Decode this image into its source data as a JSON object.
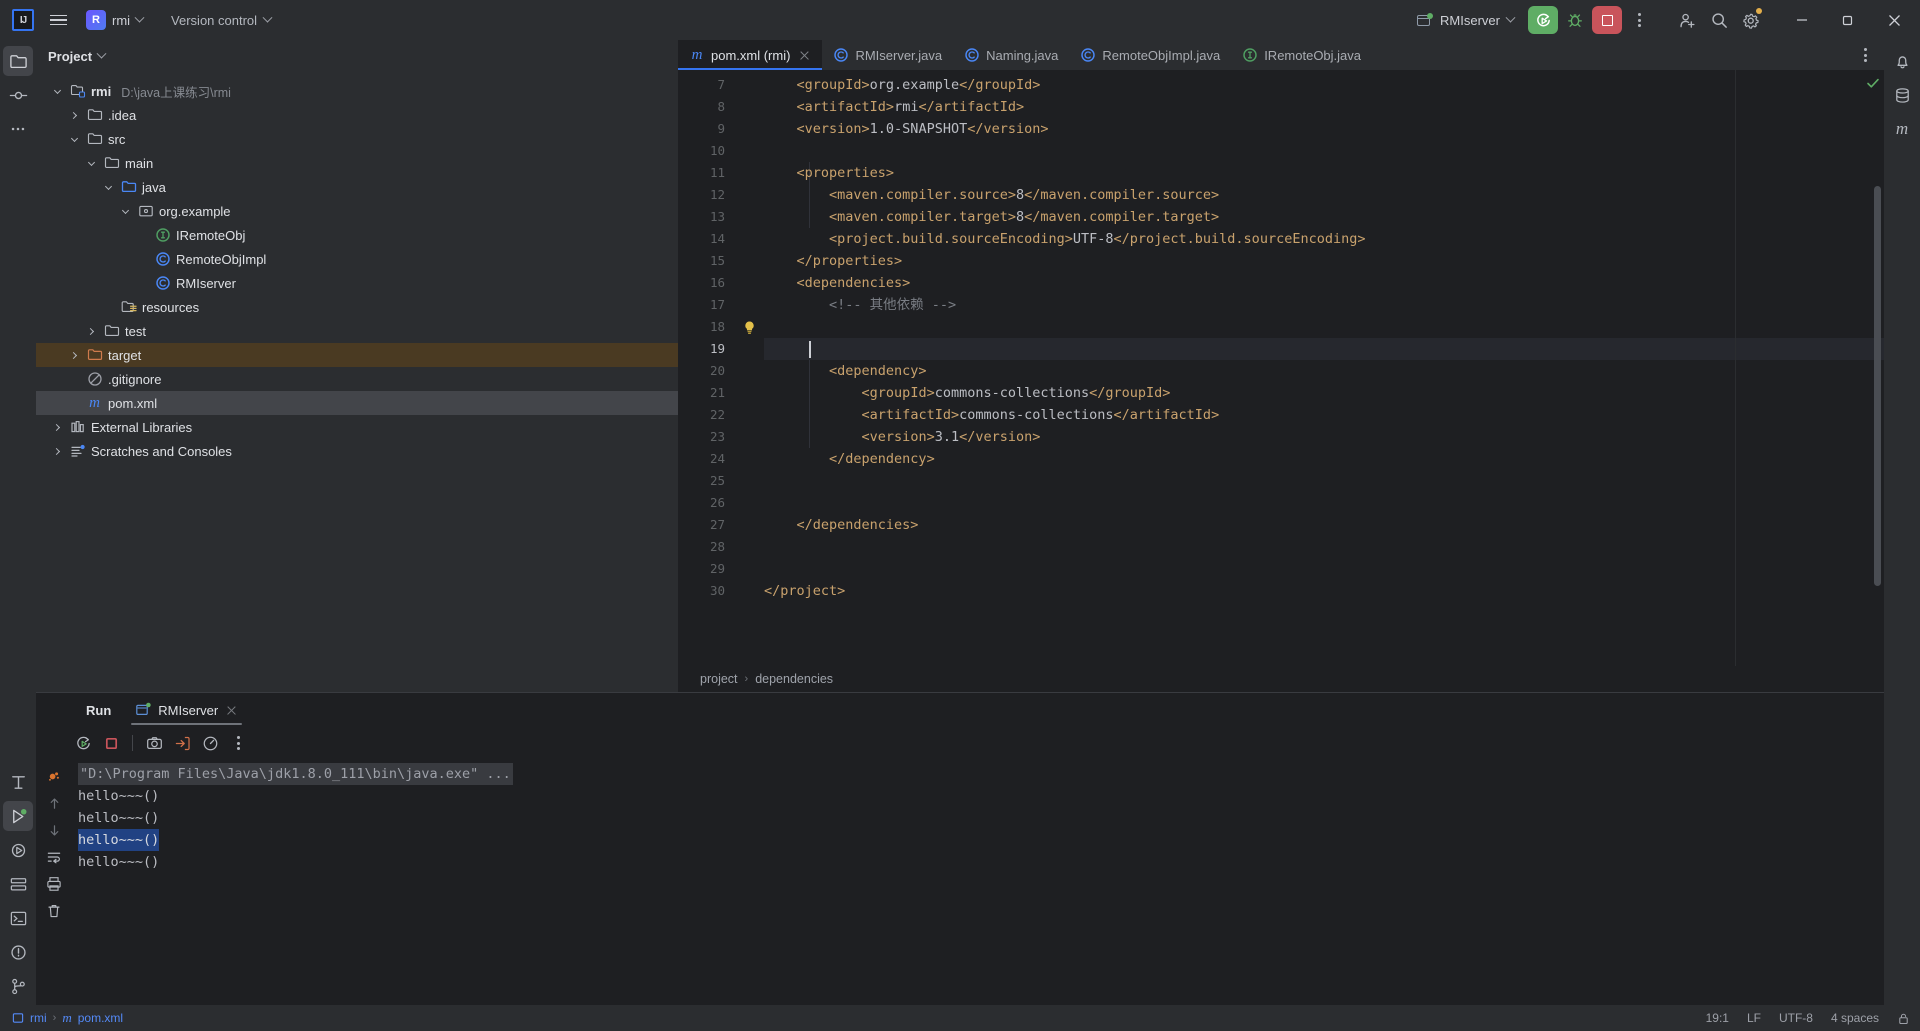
{
  "titlebar": {
    "logo": "IJ",
    "menu_icon": "hamburger-icon",
    "project_badge": "R",
    "project_name": "rmi",
    "vcs_label": "Version control",
    "run_config": "RMIserver",
    "actions": [
      "run-icon",
      "debug-icon",
      "stop-icon",
      "more-icon",
      "add-user-icon",
      "search-icon",
      "settings-icon"
    ],
    "window_controls": [
      "minimize",
      "restore",
      "close"
    ]
  },
  "left_stripe": {
    "items": [
      {
        "name": "project-tool-window",
        "icon": "folder-icon",
        "active": true
      },
      {
        "name": "commit-tool-window",
        "icon": "commit-icon",
        "active": false
      },
      {
        "name": "more-tool-windows",
        "icon": "ellipsis-icon",
        "active": false
      }
    ],
    "bottom_items": [
      {
        "name": "structure-tool-window",
        "icon": "structure-icon"
      },
      {
        "name": "run-tool-window",
        "icon": "run-play-icon",
        "active": true
      },
      {
        "name": "debug-tool-window",
        "icon": "debug-play-icon"
      },
      {
        "name": "services-tool-window",
        "icon": "services-icon"
      },
      {
        "name": "terminal-tool-window",
        "icon": "terminal-icon"
      },
      {
        "name": "problems-tool-window",
        "icon": "problems-icon"
      },
      {
        "name": "git-tool-window",
        "icon": "git-branch-icon"
      }
    ]
  },
  "right_stripe": {
    "items": [
      {
        "name": "notifications",
        "icon": "bell-icon"
      },
      {
        "name": "database",
        "icon": "database-icon"
      },
      {
        "name": "maven",
        "icon": "maven-m-icon"
      }
    ]
  },
  "project_panel": {
    "title": "Project",
    "tree": [
      {
        "depth": 0,
        "arrow": "down",
        "icon": "module-icon",
        "label": "rmi",
        "sublabel": "D:\\java上课练习\\rmi",
        "bold": true
      },
      {
        "depth": 1,
        "arrow": "right",
        "icon": "folder-icon",
        "label": ".idea",
        "sublabel": ""
      },
      {
        "depth": 1,
        "arrow": "down",
        "icon": "folder-icon",
        "label": "src",
        "sublabel": ""
      },
      {
        "depth": 2,
        "arrow": "down",
        "icon": "folder-icon",
        "label": "main",
        "sublabel": ""
      },
      {
        "depth": 3,
        "arrow": "down",
        "icon": "source-root-icon",
        "label": "java",
        "sublabel": ""
      },
      {
        "depth": 4,
        "arrow": "down",
        "icon": "package-icon",
        "label": "org.example",
        "sublabel": ""
      },
      {
        "depth": 5,
        "arrow": "none",
        "icon": "interface-icon",
        "label": "IRemoteObj",
        "sublabel": ""
      },
      {
        "depth": 5,
        "arrow": "none",
        "icon": "class-icon",
        "label": "RemoteObjImpl",
        "sublabel": ""
      },
      {
        "depth": 5,
        "arrow": "none",
        "icon": "class-icon",
        "label": "RMIserver",
        "sublabel": ""
      },
      {
        "depth": 3,
        "arrow": "none",
        "icon": "resource-root-icon",
        "label": "resources",
        "sublabel": ""
      },
      {
        "depth": 2,
        "arrow": "right",
        "icon": "folder-icon",
        "label": "test",
        "sublabel": ""
      },
      {
        "depth": 1,
        "arrow": "right",
        "icon": "excluded-folder-icon",
        "label": "target",
        "sublabel": "",
        "highlight": "orange"
      },
      {
        "depth": 1,
        "arrow": "none",
        "icon": "gitignore-icon",
        "label": ".gitignore",
        "sublabel": ""
      },
      {
        "depth": 1,
        "arrow": "none",
        "icon": "maven-m-icon",
        "label": "pom.xml",
        "sublabel": "",
        "highlight": "selected"
      },
      {
        "depth": 0,
        "arrow": "right",
        "icon": "libraries-icon",
        "label": "External Libraries",
        "sublabel": ""
      },
      {
        "depth": 0,
        "arrow": "right",
        "icon": "scratches-icon",
        "label": "Scratches and Consoles",
        "sublabel": ""
      }
    ]
  },
  "editor": {
    "tabs": [
      {
        "label": "pom.xml (rmi)",
        "icon": "maven-m-icon",
        "active": true,
        "closable": true
      },
      {
        "label": "RMIserver.java",
        "icon": "class-icon",
        "active": false,
        "closable": false
      },
      {
        "label": "Naming.java",
        "icon": "class-icon",
        "active": false,
        "closable": false
      },
      {
        "label": "RemoteObjImpl.java",
        "icon": "class-icon",
        "active": false,
        "closable": false
      },
      {
        "label": "IRemoteObj.java",
        "icon": "interface-icon",
        "active": false,
        "closable": false
      }
    ],
    "first_line_number": 7,
    "current_line": 19,
    "bulb_line": 18,
    "lines": [
      {
        "n": 7,
        "indent": 4,
        "segs": [
          {
            "t": "tag",
            "s": "<groupId>"
          },
          {
            "t": "val",
            "s": "org.example"
          },
          {
            "t": "tag",
            "s": "</groupId>"
          }
        ]
      },
      {
        "n": 8,
        "indent": 4,
        "segs": [
          {
            "t": "tag",
            "s": "<artifactId>"
          },
          {
            "t": "val",
            "s": "rmi"
          },
          {
            "t": "tag",
            "s": "</artifactId>"
          }
        ]
      },
      {
        "n": 9,
        "indent": 4,
        "segs": [
          {
            "t": "tag",
            "s": "<version>"
          },
          {
            "t": "val",
            "s": "1.0-SNAPSHOT"
          },
          {
            "t": "tag",
            "s": "</version>"
          }
        ]
      },
      {
        "n": 10,
        "indent": 0,
        "segs": []
      },
      {
        "n": 11,
        "indent": 4,
        "segs": [
          {
            "t": "tag",
            "s": "<properties>"
          }
        ]
      },
      {
        "n": 12,
        "indent": 8,
        "segs": [
          {
            "t": "tag",
            "s": "<maven.compiler.source>"
          },
          {
            "t": "val",
            "s": "8"
          },
          {
            "t": "tag",
            "s": "</maven.compiler.source>"
          }
        ]
      },
      {
        "n": 13,
        "indent": 8,
        "segs": [
          {
            "t": "tag",
            "s": "<maven.compiler.target>"
          },
          {
            "t": "val",
            "s": "8"
          },
          {
            "t": "tag",
            "s": "</maven.compiler.target>"
          }
        ]
      },
      {
        "n": 14,
        "indent": 8,
        "segs": [
          {
            "t": "tag",
            "s": "<project.build.sourceEncoding>"
          },
          {
            "t": "val",
            "s": "UTF-8"
          },
          {
            "t": "tag",
            "s": "</project.build.sourceEncoding>"
          }
        ]
      },
      {
        "n": 15,
        "indent": 4,
        "segs": [
          {
            "t": "tag",
            "s": "</properties>"
          }
        ]
      },
      {
        "n": 16,
        "indent": 4,
        "segs": [
          {
            "t": "tag",
            "s": "<dependencies>"
          }
        ]
      },
      {
        "n": 17,
        "indent": 8,
        "segs": [
          {
            "t": "cmt",
            "s": "<!-- 其他依赖 -->"
          }
        ]
      },
      {
        "n": 18,
        "indent": 0,
        "segs": []
      },
      {
        "n": 19,
        "indent": 0,
        "segs": []
      },
      {
        "n": 20,
        "indent": 8,
        "segs": [
          {
            "t": "tag",
            "s": "<dependency>"
          }
        ]
      },
      {
        "n": 21,
        "indent": 12,
        "segs": [
          {
            "t": "tag",
            "s": "<groupId>"
          },
          {
            "t": "val",
            "s": "commons-collections"
          },
          {
            "t": "tag",
            "s": "</groupId>"
          }
        ]
      },
      {
        "n": 22,
        "indent": 12,
        "segs": [
          {
            "t": "tag",
            "s": "<artifactId>"
          },
          {
            "t": "val",
            "s": "commons-collections"
          },
          {
            "t": "tag",
            "s": "</artifactId>"
          }
        ]
      },
      {
        "n": 23,
        "indent": 12,
        "segs": [
          {
            "t": "tag",
            "s": "<version>"
          },
          {
            "t": "val",
            "s": "3.1"
          },
          {
            "t": "tag",
            "s": "</version>"
          }
        ]
      },
      {
        "n": 24,
        "indent": 8,
        "segs": [
          {
            "t": "tag",
            "s": "</dependency>"
          }
        ]
      },
      {
        "n": 25,
        "indent": 0,
        "segs": []
      },
      {
        "n": 26,
        "indent": 0,
        "segs": []
      },
      {
        "n": 27,
        "indent": 4,
        "segs": [
          {
            "t": "tag",
            "s": "</dependencies>"
          }
        ]
      },
      {
        "n": 28,
        "indent": 0,
        "segs": []
      },
      {
        "n": 29,
        "indent": 0,
        "segs": []
      },
      {
        "n": 30,
        "indent": 0,
        "segs": [
          {
            "t": "tag",
            "s": "</project>"
          }
        ]
      }
    ],
    "breadcrumb": [
      "project",
      "dependencies"
    ],
    "inspection_status": "ok-check"
  },
  "run_panel": {
    "tabs": [
      {
        "label": "Run",
        "icon": "",
        "selected": false,
        "bold": true
      },
      {
        "label": "RMIserver",
        "icon": "run-config-icon",
        "selected": true,
        "closable": true
      }
    ],
    "toolbar": [
      "rerun-icon",
      "stop-icon",
      "camera-icon",
      "export-icon",
      "profiler-icon",
      "more-icon"
    ],
    "gutter_icons": [
      "ant-icon",
      "up-arrow-icon",
      "down-arrow-icon",
      "soft-wrap-icon",
      "print-icon",
      "trash-icon"
    ],
    "console_lines": [
      {
        "text": "\"D:\\Program Files\\Java\\jdk1.8.0_111\\bin\\java.exe\" ...",
        "style": "command"
      },
      {
        "text": "hello~~~()",
        "style": "normal"
      },
      {
        "text": "hello~~~()",
        "style": "normal"
      },
      {
        "text": "hello~~~()",
        "style": "selected"
      },
      {
        "text": "hello~~~()",
        "style": "normal"
      }
    ]
  },
  "statusbar": {
    "breadcrumb": [
      "rmi",
      "pom.xml"
    ],
    "caret_position": "19:1",
    "line_separator": "LF",
    "encoding": "UTF-8",
    "indent": "4 spaces",
    "lock_icon": "lock-icon"
  },
  "colors": {
    "accent_blue": "#3574f0",
    "run_green": "#5fad65",
    "stop_red": "#c9545b",
    "tag_gold": "#c9a26d",
    "bg_editor": "#1e1f22",
    "bg_panel": "#2b2d30",
    "selection_blue": "#214283",
    "target_orange": "#4a3a22"
  }
}
